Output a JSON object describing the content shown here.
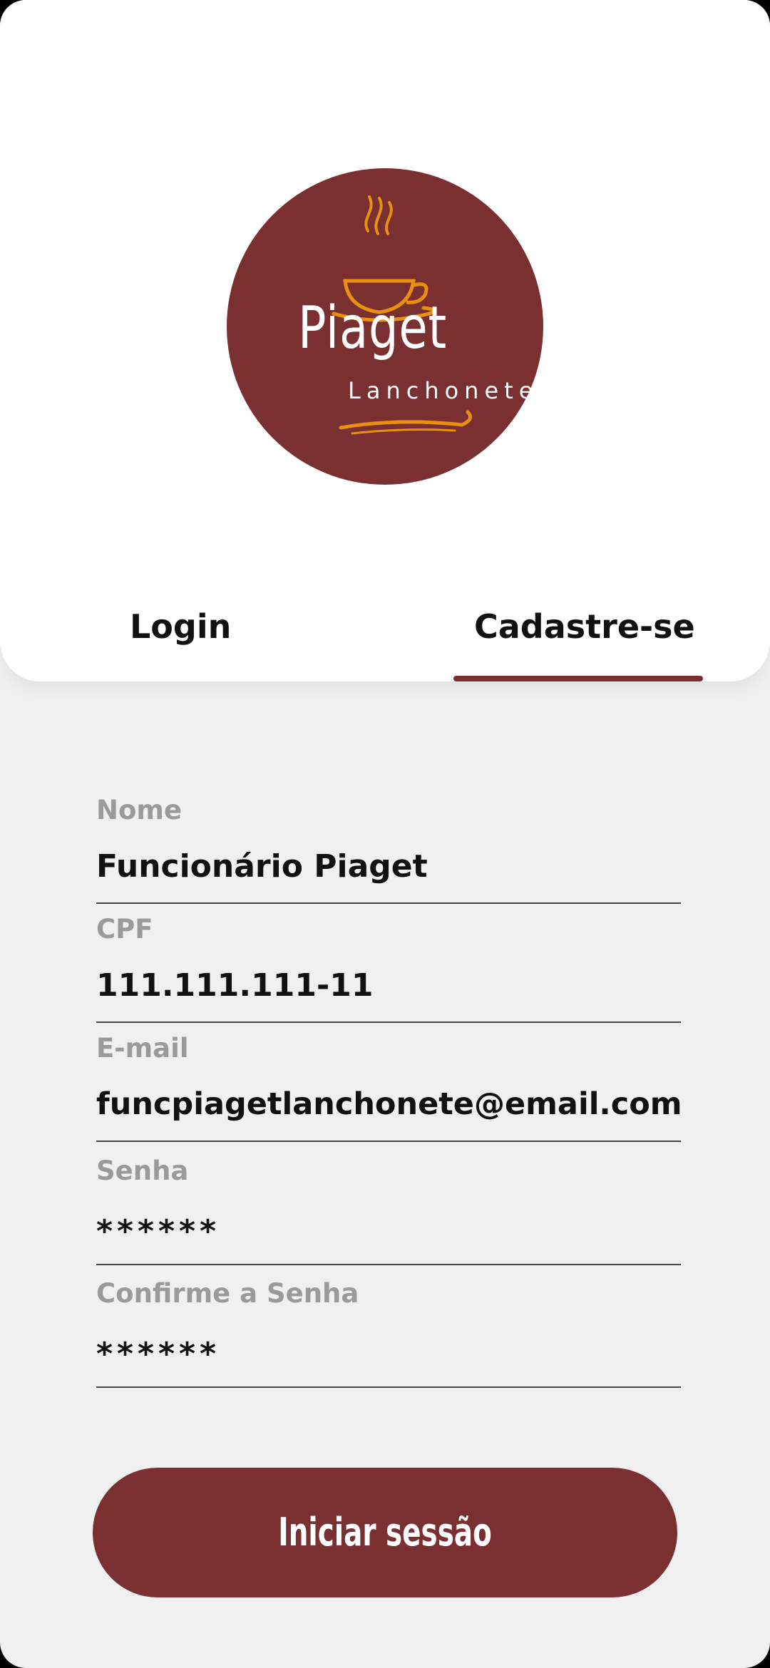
{
  "theme": {
    "accent": "#7a2f31",
    "logo_accent": "#e8900f",
    "background": "#f0f0f0",
    "card": "#ffffff",
    "label_color": "#9a9a9a",
    "text_color": "#111111"
  },
  "logo": {
    "brand": "Piaget",
    "subtitle": "Lanchonete",
    "icon": "coffee-cup-icon"
  },
  "tabs": {
    "login_label": "Login",
    "signup_label": "Cadastre-se",
    "active": "Cadastre-se"
  },
  "form": {
    "name": {
      "label": "Nome",
      "value": "Funcionário Piaget"
    },
    "cpf": {
      "label": "CPF",
      "value": "111.111.111-11"
    },
    "email": {
      "label": "E-mail",
      "value": "funcpiagetlanchonete@email.com"
    },
    "password": {
      "label": "Senha",
      "value": "******"
    },
    "confirm_password": {
      "label": "Confirme a Senha",
      "value": "******"
    }
  },
  "submit": {
    "label": "Iniciar sessão"
  }
}
